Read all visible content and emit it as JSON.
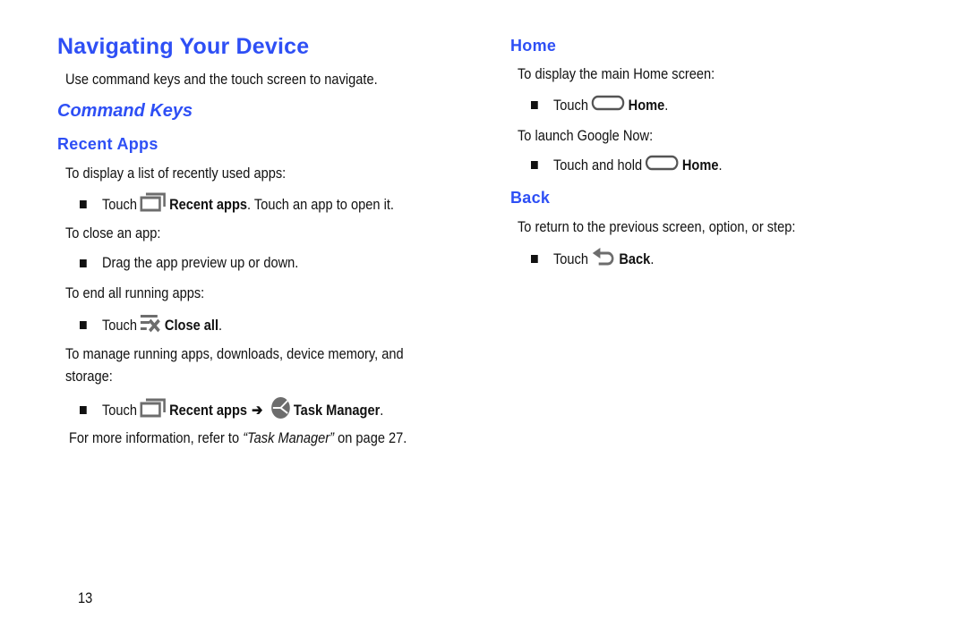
{
  "page": {
    "title": "Navigating Your Device",
    "intro": "Use command keys and the touch screen to navigate.",
    "page_number": "13"
  },
  "command_keys": {
    "heading": "Command Keys"
  },
  "recent_apps": {
    "heading": "Recent Apps",
    "p1": "To display a list of recently used apps:",
    "b1": {
      "prefix": "Touch",
      "icon": "recent-apps-icon",
      "bold": "Recent apps",
      "suffix": ". Touch an app to open it."
    },
    "p2": "To close an app:",
    "b2": {
      "text": "Drag the app preview up or down."
    },
    "p3": "To end all running apps:",
    "b3": {
      "prefix": "Touch",
      "icon": "close-all-icon",
      "bold": "Close all",
      "suffix": "."
    },
    "p4_line1": "To manage running apps, downloads, device memory, and",
    "p4_line2": "storage:",
    "b4": {
      "prefix": "Touch",
      "icon1": "recent-apps-icon",
      "bold1": "Recent apps",
      "arrow": "➔",
      "icon2": "task-manager-icon",
      "bold2": "Task Manager",
      "suffix": "."
    },
    "ref": {
      "prefix": "For more information, refer to ",
      "italic": "“Task Manager”",
      "suffix": " on page 27."
    }
  },
  "home": {
    "heading": "Home",
    "p1": "To display the main Home screen:",
    "b1": {
      "prefix": "Touch",
      "icon": "home-key-icon",
      "bold": "Home",
      "suffix": "."
    },
    "p2": "To launch Google Now:",
    "b2": {
      "prefix": "Touch and hold",
      "icon": "home-key-icon",
      "bold": "Home",
      "suffix": "."
    }
  },
  "back": {
    "heading": "Back",
    "p1": "To return to the previous screen, option, or step:",
    "b1": {
      "prefix": "Touch",
      "icon": "back-icon",
      "bold": "Back",
      "suffix": "."
    }
  },
  "colors": {
    "heading": "#2e4ff5",
    "text": "#111111",
    "icon": "#6d6d6d"
  }
}
